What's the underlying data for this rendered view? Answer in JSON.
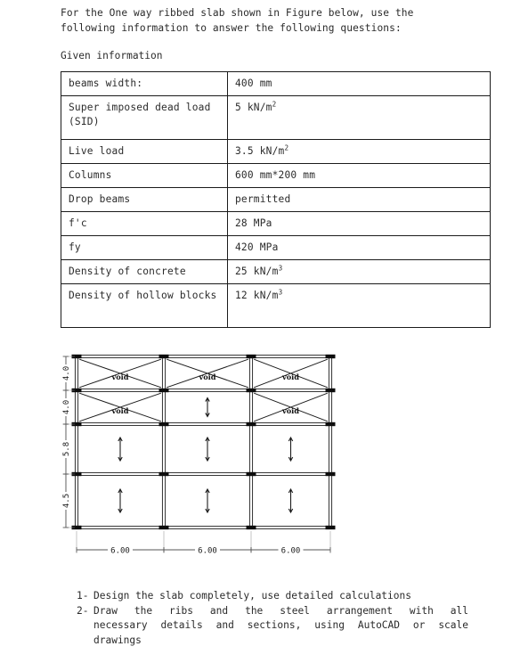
{
  "document": {
    "intro": "For the One way ribbed slab shown in Figure below, use the\nfollowing information to answer the following questions:",
    "given_label": "Given information"
  },
  "given_table": {
    "rows": [
      {
        "key": "beams width:",
        "value": "400 mm",
        "unit_sup": ""
      },
      {
        "key": "Super imposed dead\nload (SID)",
        "value": "5 kN/m",
        "unit_sup": "2"
      },
      {
        "key": "Live load",
        "value": "3.5 kN/m",
        "unit_sup": "2"
      },
      {
        "key": "Columns",
        "value": "600 mm*200 mm",
        "unit_sup": ""
      },
      {
        "key": "Drop beams",
        "value": "permitted",
        "unit_sup": ""
      },
      {
        "key": "f'c",
        "value": "28 MPa",
        "unit_sup": ""
      },
      {
        "key": "fy",
        "value": "420 MPa",
        "unit_sup": ""
      },
      {
        "key": "Density of concrete",
        "value": "25 kN/m",
        "unit_sup": "3"
      },
      {
        "key": "Density of hollow\nblocks",
        "value": "12 kN/m",
        "unit_sup": "3"
      }
    ]
  },
  "plan": {
    "horizontal_dimensions": [
      "6.00",
      "6.00",
      "6.00"
    ],
    "vertical_dimensions": [
      "4.0",
      "4.0",
      "5.8",
      "4.5"
    ],
    "void_label": "void",
    "bays": [
      {
        "row": 1,
        "bay": 1,
        "type": "void"
      },
      {
        "row": 1,
        "bay": 2,
        "type": "void"
      },
      {
        "row": 1,
        "bay": 3,
        "type": "void"
      },
      {
        "row": 2,
        "bay": 1,
        "type": "void"
      },
      {
        "row": 2,
        "bay": 2,
        "type": "span-arrow"
      },
      {
        "row": 2,
        "bay": 3,
        "type": "void"
      },
      {
        "row": 3,
        "bay": 1,
        "type": "span-arrow"
      },
      {
        "row": 3,
        "bay": 2,
        "type": "span-arrow"
      },
      {
        "row": 3,
        "bay": 3,
        "type": "span-arrow"
      },
      {
        "row": 4,
        "bay": 1,
        "type": "span-arrow"
      },
      {
        "row": 4,
        "bay": 2,
        "type": "span-arrow"
      },
      {
        "row": 4,
        "bay": 3,
        "type": "span-arrow"
      }
    ]
  },
  "questions": [
    {
      "num": "1-",
      "lines": [
        "Design the slab completely, use detailed calculations"
      ]
    },
    {
      "num": "2-",
      "lines": [
        "Draw the ribs and the steel arrangement with all",
        "necessary details and sections, using AutoCAD or scale",
        "drawings"
      ]
    }
  ]
}
